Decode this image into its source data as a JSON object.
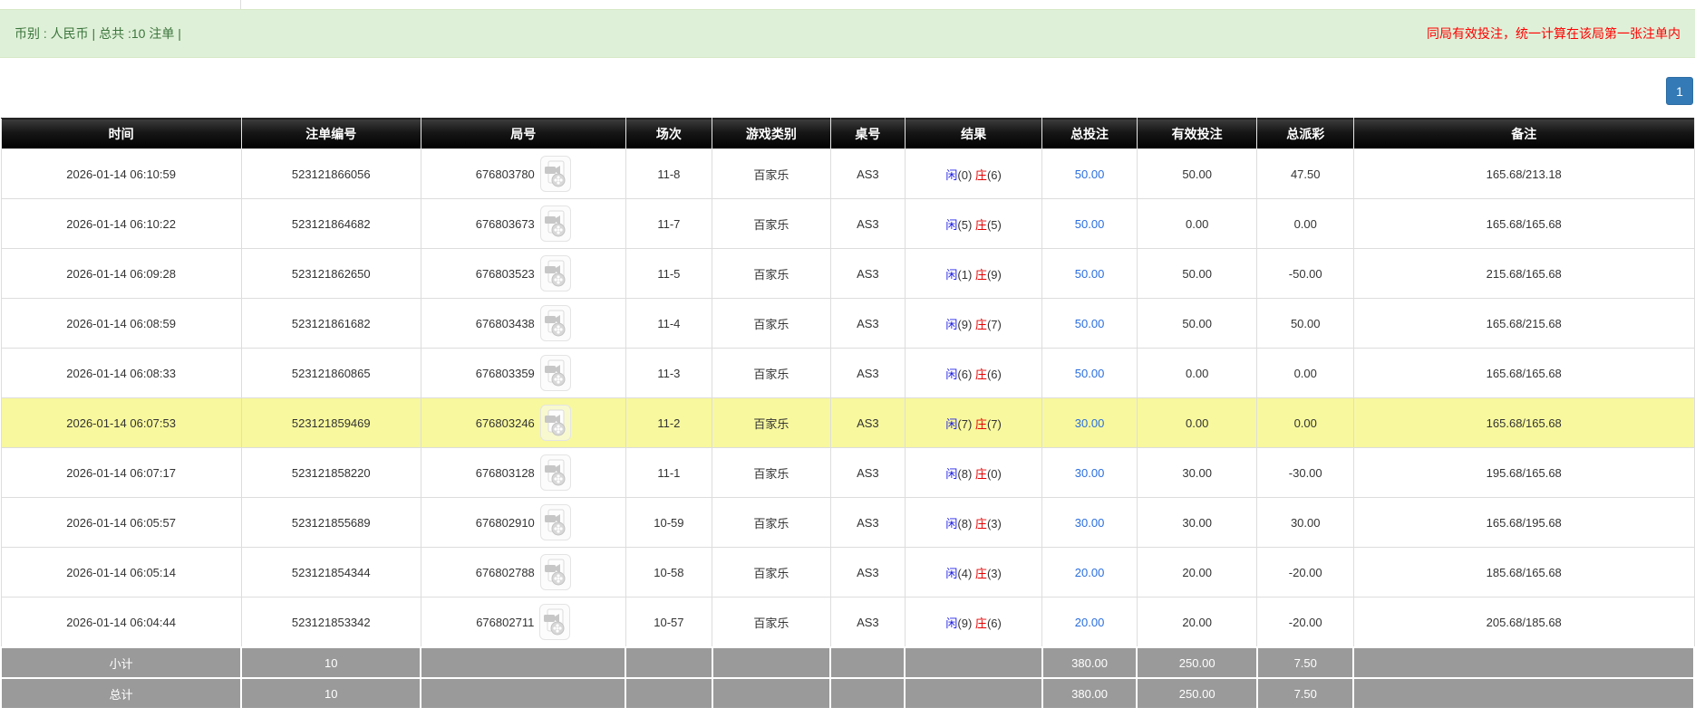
{
  "summary_bar": {
    "left_text": "币别 : 人民币 | 总共 :10 注单 |",
    "right_text": "同局有效投注，统一计算在该局第一张注单内"
  },
  "pagination": {
    "current_page": "1"
  },
  "table": {
    "columns": [
      "时间",
      "注单编号",
      "局号",
      "场次",
      "游戏类别",
      "桌号",
      "结果",
      "总投注",
      "有效投注",
      "总派彩",
      "备注"
    ],
    "rows": [
      {
        "time": "2026-01-14 06:10:59",
        "bet_id": "523121866056",
        "round_id": "676803780",
        "session": "11-8",
        "game": "百家乐",
        "table_no": "AS3",
        "result": {
          "player_label": "闲",
          "player_score": "(0)",
          "banker_label": "庄",
          "banker_score": "(6)"
        },
        "total_bet": "50.00",
        "valid_bet": "50.00",
        "payout": "47.50",
        "remark": "165.68/213.18",
        "highlight": false
      },
      {
        "time": "2026-01-14 06:10:22",
        "bet_id": "523121864682",
        "round_id": "676803673",
        "session": "11-7",
        "game": "百家乐",
        "table_no": "AS3",
        "result": {
          "player_label": "闲",
          "player_score": "(5)",
          "banker_label": "庄",
          "banker_score": "(5)"
        },
        "total_bet": "50.00",
        "valid_bet": "0.00",
        "payout": "0.00",
        "remark": "165.68/165.68",
        "highlight": false
      },
      {
        "time": "2026-01-14 06:09:28",
        "bet_id": "523121862650",
        "round_id": "676803523",
        "session": "11-5",
        "game": "百家乐",
        "table_no": "AS3",
        "result": {
          "player_label": "闲",
          "player_score": "(1)",
          "banker_label": "庄",
          "banker_score": "(9)"
        },
        "total_bet": "50.00",
        "valid_bet": "50.00",
        "payout": "-50.00",
        "remark": "215.68/165.68",
        "highlight": false
      },
      {
        "time": "2026-01-14 06:08:59",
        "bet_id": "523121861682",
        "round_id": "676803438",
        "session": "11-4",
        "game": "百家乐",
        "table_no": "AS3",
        "result": {
          "player_label": "闲",
          "player_score": "(9)",
          "banker_label": "庄",
          "banker_score": "(7)"
        },
        "total_bet": "50.00",
        "valid_bet": "50.00",
        "payout": "50.00",
        "remark": "165.68/215.68",
        "highlight": false
      },
      {
        "time": "2026-01-14 06:08:33",
        "bet_id": "523121860865",
        "round_id": "676803359",
        "session": "11-3",
        "game": "百家乐",
        "table_no": "AS3",
        "result": {
          "player_label": "闲",
          "player_score": "(6)",
          "banker_label": "庄",
          "banker_score": "(6)"
        },
        "total_bet": "50.00",
        "valid_bet": "0.00",
        "payout": "0.00",
        "remark": "165.68/165.68",
        "highlight": false
      },
      {
        "time": "2026-01-14 06:07:53",
        "bet_id": "523121859469",
        "round_id": "676803246",
        "session": "11-2",
        "game": "百家乐",
        "table_no": "AS3",
        "result": {
          "player_label": "闲",
          "player_score": "(7)",
          "banker_label": "庄",
          "banker_score": "(7)"
        },
        "total_bet": "30.00",
        "valid_bet": "0.00",
        "payout": "0.00",
        "remark": "165.68/165.68",
        "highlight": true
      },
      {
        "time": "2026-01-14 06:07:17",
        "bet_id": "523121858220",
        "round_id": "676803128",
        "session": "11-1",
        "game": "百家乐",
        "table_no": "AS3",
        "result": {
          "player_label": "闲",
          "player_score": "(8)",
          "banker_label": "庄",
          "banker_score": "(0)"
        },
        "total_bet": "30.00",
        "valid_bet": "30.00",
        "payout": "-30.00",
        "remark": "195.68/165.68",
        "highlight": false
      },
      {
        "time": "2026-01-14 06:05:57",
        "bet_id": "523121855689",
        "round_id": "676802910",
        "session": "10-59",
        "game": "百家乐",
        "table_no": "AS3",
        "result": {
          "player_label": "闲",
          "player_score": "(8)",
          "banker_label": "庄",
          "banker_score": "(3)"
        },
        "total_bet": "30.00",
        "valid_bet": "30.00",
        "payout": "30.00",
        "remark": "165.68/195.68",
        "highlight": false
      },
      {
        "time": "2026-01-14 06:05:14",
        "bet_id": "523121854344",
        "round_id": "676802788",
        "session": "10-58",
        "game": "百家乐",
        "table_no": "AS3",
        "result": {
          "player_label": "闲",
          "player_score": "(4)",
          "banker_label": "庄",
          "banker_score": "(3)"
        },
        "total_bet": "20.00",
        "valid_bet": "20.00",
        "payout": "-20.00",
        "remark": "185.68/165.68",
        "highlight": false
      },
      {
        "time": "2026-01-14 06:04:44",
        "bet_id": "523121853342",
        "round_id": "676802711",
        "session": "10-57",
        "game": "百家乐",
        "table_no": "AS3",
        "result": {
          "player_label": "闲",
          "player_score": "(9)",
          "banker_label": "庄",
          "banker_score": "(6)"
        },
        "total_bet": "20.00",
        "valid_bet": "20.00",
        "payout": "-20.00",
        "remark": "205.68/185.68",
        "highlight": false
      }
    ],
    "subtotal": {
      "label": "小计",
      "count": "10",
      "total_bet": "380.00",
      "valid_bet": "250.00",
      "payout": "7.50"
    },
    "total": {
      "label": "总计",
      "count": "10",
      "total_bet": "380.00",
      "valid_bet": "250.00",
      "payout": "7.50"
    },
    "video_icon_name": "video-icon"
  },
  "colors": {
    "alert_bg": "#dff0d8",
    "alert_border": "#d6e9c6",
    "alert_text": "#3c763d",
    "warning_red": "#ff0000",
    "page_blue": "#337ab7",
    "header_black": "#000000",
    "highlight_yellow": "#f8f89e",
    "link_blue": "#2a6edf",
    "player_blue": "#1f1fe8",
    "banker_red": "#e60000",
    "negative_red": "#e60000",
    "summary_gray": "#9a9a9a"
  }
}
